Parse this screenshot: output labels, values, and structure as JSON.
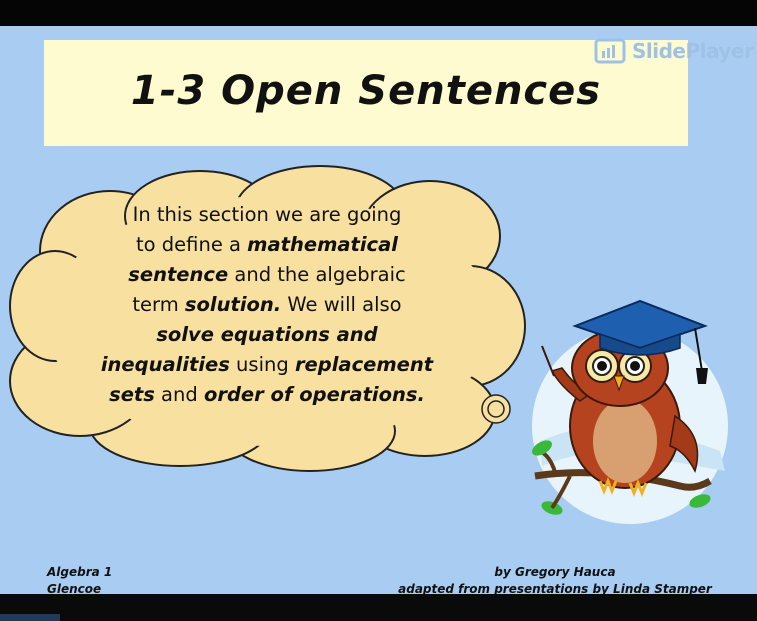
{
  "slide": {
    "title": "1-3 Open Sentences",
    "watermark": "SlidePlayer",
    "body_lines": [
      [
        {
          "t": "In this section we are going",
          "b": false
        }
      ],
      [
        {
          "t": "to define a ",
          "b": false
        },
        {
          "t": "mathematical",
          "b": true
        }
      ],
      [
        {
          "t": "sentence",
          "b": true
        },
        {
          "t": " and the algebraic",
          "b": false
        }
      ],
      [
        {
          "t": "term ",
          "b": false
        },
        {
          "t": "solution.",
          "b": true
        },
        {
          "t": " We will also",
          "b": false
        }
      ],
      [
        {
          "t": "solve equations and",
          "b": true
        }
      ],
      [
        {
          "t": "inequalities",
          "b": true
        },
        {
          "t": " using ",
          "b": false
        },
        {
          "t": "replacement",
          "b": true
        }
      ],
      [
        {
          "t": "sets",
          "b": true
        },
        {
          "t": " and ",
          "b": false
        },
        {
          "t": "order of operations.",
          "b": true
        }
      ]
    ],
    "footer_left": {
      "line1": "Algebra 1",
      "line2": "Glencoe"
    },
    "footer_right": {
      "line1": "by Gregory Hauca",
      "line2": "adapted from presentations by Linda Stamper"
    }
  },
  "colors": {
    "slide_background": "#a9cdf2",
    "title_box": "#fdfbcf",
    "cloud_fill": "#f8e1a0",
    "owl_body": "#b5431f",
    "cap": "#1f5fb0"
  },
  "icons": [
    "slideplayer-logo-icon",
    "thought-cloud-icon",
    "owl-graduate-icon"
  ]
}
